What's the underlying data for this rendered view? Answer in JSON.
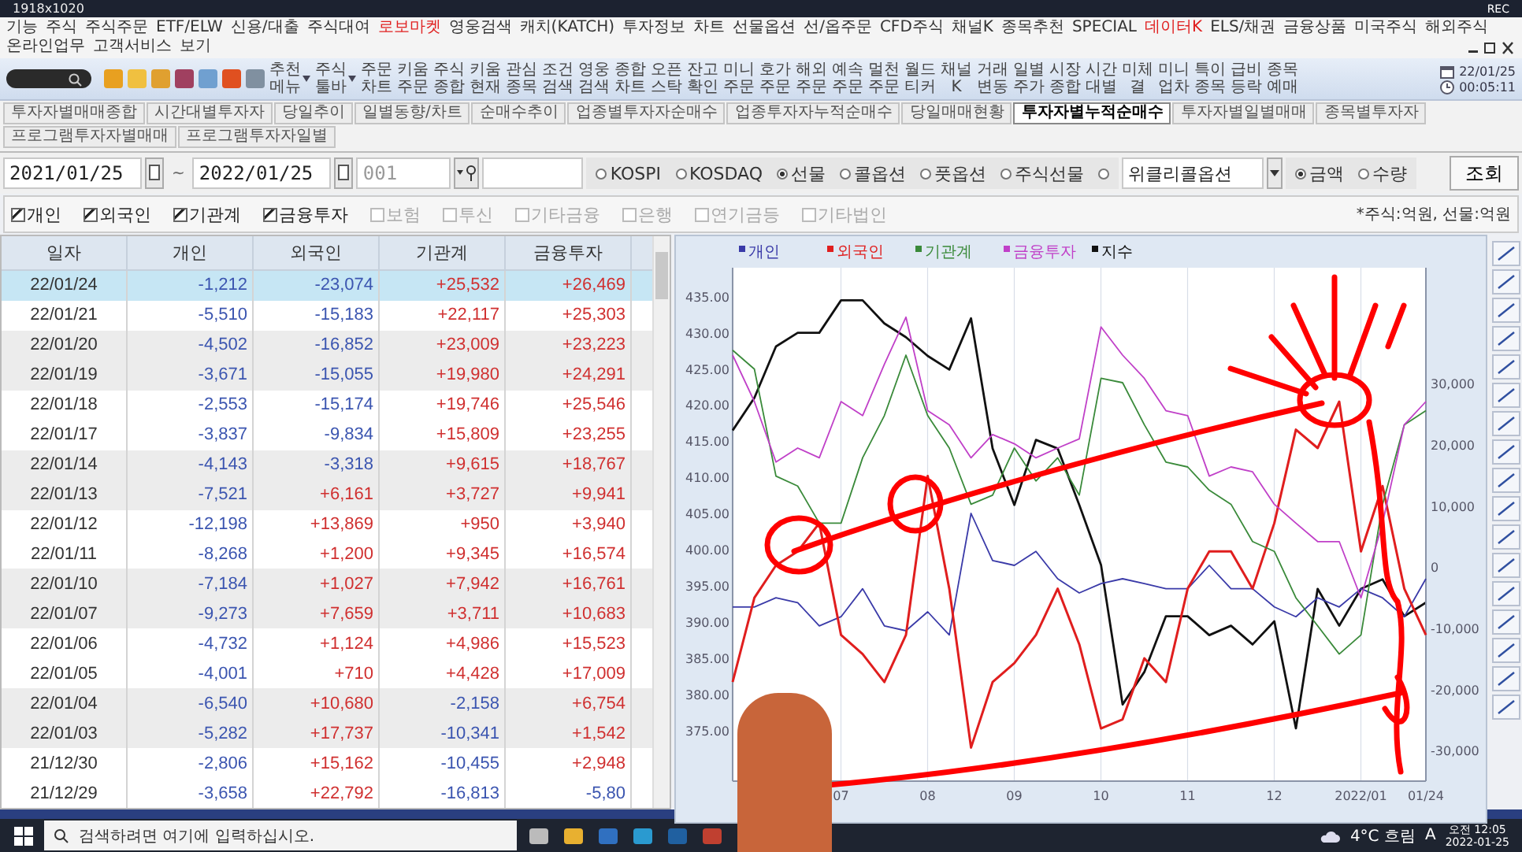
{
  "window": {
    "title": "1918x1020",
    "recording": "REC"
  },
  "menu": [
    {
      "label": "기능",
      "highlighted": false
    },
    {
      "label": "주식",
      "highlighted": false
    },
    {
      "label": "주식주문",
      "highlighted": false
    },
    {
      "label": "ETF/ELW",
      "highlighted": false
    },
    {
      "label": "신용/대출",
      "highlighted": false
    },
    {
      "label": "주식대여",
      "highlighted": false
    },
    {
      "label": "로보마켓",
      "highlighted": true
    },
    {
      "label": "영웅검색",
      "highlighted": false
    },
    {
      "label": "캐치(KATCH)",
      "highlighted": false
    },
    {
      "label": "투자정보",
      "highlighted": false
    },
    {
      "label": "차트",
      "highlighted": false
    },
    {
      "label": "선물옵션",
      "highlighted": false
    },
    {
      "label": "선/옵주문",
      "highlighted": false
    },
    {
      "label": "CFD주식",
      "highlighted": false
    },
    {
      "label": "채널K",
      "highlighted": false
    },
    {
      "label": "종목추천",
      "highlighted": false
    },
    {
      "label": "SPECIAL",
      "highlighted": false
    },
    {
      "label": "데이터K",
      "highlighted": true
    },
    {
      "label": "ELS/채권",
      "highlighted": false
    },
    {
      "label": "금융상품",
      "highlighted": false
    },
    {
      "label": "미국주식",
      "highlighted": false
    },
    {
      "label": "해외주식",
      "highlighted": false
    },
    {
      "label": "온라인업무",
      "highlighted": false
    },
    {
      "label": "고객서비스",
      "highlighted": false
    },
    {
      "label": "보기",
      "highlighted": false
    }
  ],
  "toolbar": {
    "buttons": [
      {
        "label": "추천 메뉴",
        "has_menu": true
      },
      {
        "label": "주식 툴바",
        "has_menu": true
      },
      {
        "label": "주문 차트",
        "has_menu": false
      },
      {
        "label": "키움 주문",
        "has_menu": false
      },
      {
        "label": "주식 종합",
        "has_menu": false
      },
      {
        "label": "키움 현재",
        "has_menu": false
      },
      {
        "label": "관심 종목",
        "has_menu": false
      },
      {
        "label": "조건 검색",
        "has_menu": false
      },
      {
        "label": "영웅 검색",
        "has_menu": false
      },
      {
        "label": "종합 차트",
        "has_menu": false
      },
      {
        "label": "오픈 스탁",
        "has_menu": false
      },
      {
        "label": "잔고 확인",
        "has_menu": false
      },
      {
        "label": "미니 주문",
        "has_menu": false
      },
      {
        "label": "호가 주문",
        "has_menu": false
      },
      {
        "label": "해외 주문",
        "has_menu": false
      },
      {
        "label": "예속 주문",
        "has_menu": false
      },
      {
        "label": "멀천 주문",
        "has_menu": false
      },
      {
        "label": "월드 티커",
        "has_menu": false
      },
      {
        "label": "채널 K",
        "has_menu": false
      },
      {
        "label": "거래 변동",
        "has_menu": false
      },
      {
        "label": "일별 주가",
        "has_menu": false
      },
      {
        "label": "시장 종합",
        "has_menu": false
      },
      {
        "label": "시간 대별",
        "has_menu": false
      },
      {
        "label": "미체 결",
        "has_menu": false
      },
      {
        "label": "미니 업차",
        "has_menu": false
      },
      {
        "label": "특이 종목",
        "has_menu": false
      },
      {
        "label": "급비 등락",
        "has_menu": false
      },
      {
        "label": "종목 예매",
        "has_menu": false
      }
    ],
    "date": "22/01/25",
    "time": "00:05:11"
  },
  "tabs": [
    {
      "label": "투자자별매매종합",
      "selected": false
    },
    {
      "label": "시간대별투자자",
      "selected": false
    },
    {
      "label": "당일추이",
      "selected": false
    },
    {
      "label": "일별동향/차트",
      "selected": false
    },
    {
      "label": "순매수추이",
      "selected": false
    },
    {
      "label": "업종별투자자순매수",
      "selected": false
    },
    {
      "label": "업종투자자누적순매수",
      "selected": false
    },
    {
      "label": "당일매매현황",
      "selected": false
    },
    {
      "label": "투자자별누적순매수",
      "selected": true
    },
    {
      "label": "투자자별일별매매",
      "selected": false
    },
    {
      "label": "종목별투자자",
      "selected": false
    },
    {
      "label": "프로그램투자자별매매",
      "selected": false
    },
    {
      "label": "프로그램투자자일별",
      "selected": false
    }
  ],
  "query": {
    "start_date": "2021/01/25",
    "range_sep": "~",
    "end_date": "2022/01/25",
    "code": "001",
    "markets": [
      {
        "label": "KOSPI",
        "selected": false
      },
      {
        "label": "KOSDAQ",
        "selected": false
      },
      {
        "label": "선물",
        "selected": true
      },
      {
        "label": "콜옵션",
        "selected": false
      },
      {
        "label": "풋옵션",
        "selected": false
      },
      {
        "label": "주식선물",
        "selected": false
      }
    ],
    "weekly_radio": {
      "selected": false
    },
    "weekly_option": "위클리콜옵션",
    "units": [
      {
        "label": "금액",
        "selected": true
      },
      {
        "label": "수량",
        "selected": false
      }
    ],
    "search_button": "조회"
  },
  "investors": [
    {
      "label": "개인",
      "checked": true,
      "disabled": false
    },
    {
      "label": "외국인",
      "checked": true,
      "disabled": false
    },
    {
      "label": "기관계",
      "checked": true,
      "disabled": false
    },
    {
      "label": "금융투자",
      "checked": true,
      "disabled": false
    },
    {
      "label": "보험",
      "checked": false,
      "disabled": true
    },
    {
      "label": "투신",
      "checked": false,
      "disabled": true
    },
    {
      "label": "기타금융",
      "checked": false,
      "disabled": true
    },
    {
      "label": "은행",
      "checked": false,
      "disabled": true
    },
    {
      "label": "연기금등",
      "checked": false,
      "disabled": true
    },
    {
      "label": "기타법인",
      "checked": false,
      "disabled": true
    }
  ],
  "unit_note": "*주식:억원, 선물:억원",
  "table": {
    "columns": [
      "일자",
      "개인",
      "외국인",
      "기관계",
      "금융투자"
    ],
    "rows": [
      {
        "date": "22/01/24",
        "selected": true,
        "values": [
          {
            "text": "-1,212",
            "color": "#3b55b0"
          },
          {
            "text": "-23,074",
            "color": "#3b55b0"
          },
          {
            "text": "+25,532",
            "color": "#d03030"
          },
          {
            "text": "+26,469",
            "color": "#d03030"
          }
        ]
      },
      {
        "date": "22/01/21",
        "selected": false,
        "values": [
          {
            "text": "-5,510",
            "color": "#3b55b0"
          },
          {
            "text": "-15,183",
            "color": "#3b55b0"
          },
          {
            "text": "+22,117",
            "color": "#d03030"
          },
          {
            "text": "+25,303",
            "color": "#d03030"
          }
        ]
      },
      {
        "date": "22/01/20",
        "selected": false,
        "values": [
          {
            "text": "-4,502",
            "color": "#3b55b0"
          },
          {
            "text": "-16,852",
            "color": "#3b55b0"
          },
          {
            "text": "+23,009",
            "color": "#d03030"
          },
          {
            "text": "+23,223",
            "color": "#d03030"
          }
        ]
      },
      {
        "date": "22/01/19",
        "selected": false,
        "values": [
          {
            "text": "-3,671",
            "color": "#3b55b0"
          },
          {
            "text": "-15,055",
            "color": "#3b55b0"
          },
          {
            "text": "+19,980",
            "color": "#d03030"
          },
          {
            "text": "+24,291",
            "color": "#d03030"
          }
        ]
      },
      {
        "date": "22/01/18",
        "selected": false,
        "values": [
          {
            "text": "-2,553",
            "color": "#3b55b0"
          },
          {
            "text": "-15,174",
            "color": "#3b55b0"
          },
          {
            "text": "+19,746",
            "color": "#d03030"
          },
          {
            "text": "+25,546",
            "color": "#d03030"
          }
        ]
      },
      {
        "date": "22/01/17",
        "selected": false,
        "values": [
          {
            "text": "-3,837",
            "color": "#3b55b0"
          },
          {
            "text": "-9,834",
            "color": "#3b55b0"
          },
          {
            "text": "+15,809",
            "color": "#d03030"
          },
          {
            "text": "+23,255",
            "color": "#d03030"
          }
        ]
      },
      {
        "date": "22/01/14",
        "selected": false,
        "values": [
          {
            "text": "-4,143",
            "color": "#3b55b0"
          },
          {
            "text": "-3,318",
            "color": "#3b55b0"
          },
          {
            "text": "+9,615",
            "color": "#d03030"
          },
          {
            "text": "+18,767",
            "color": "#d03030"
          }
        ]
      },
      {
        "date": "22/01/13",
        "selected": false,
        "values": [
          {
            "text": "-7,521",
            "color": "#3b55b0"
          },
          {
            "text": "+6,161",
            "color": "#d03030"
          },
          {
            "text": "+3,727",
            "color": "#d03030"
          },
          {
            "text": "+9,941",
            "color": "#d03030"
          }
        ]
      },
      {
        "date": "22/01/12",
        "selected": false,
        "values": [
          {
            "text": "-12,198",
            "color": "#3b55b0"
          },
          {
            "text": "+13,869",
            "color": "#d03030"
          },
          {
            "text": "+950",
            "color": "#d03030"
          },
          {
            "text": "+3,940",
            "color": "#d03030"
          }
        ]
      },
      {
        "date": "22/01/11",
        "selected": false,
        "values": [
          {
            "text": "-8,268",
            "color": "#3b55b0"
          },
          {
            "text": "+1,200",
            "color": "#d03030"
          },
          {
            "text": "+9,345",
            "color": "#d03030"
          },
          {
            "text": "+16,574",
            "color": "#d03030"
          }
        ]
      },
      {
        "date": "22/01/10",
        "selected": false,
        "values": [
          {
            "text": "-7,184",
            "color": "#3b55b0"
          },
          {
            "text": "+1,027",
            "color": "#d03030"
          },
          {
            "text": "+7,942",
            "color": "#d03030"
          },
          {
            "text": "+16,761",
            "color": "#d03030"
          }
        ]
      },
      {
        "date": "22/01/07",
        "selected": false,
        "values": [
          {
            "text": "-9,273",
            "color": "#3b55b0"
          },
          {
            "text": "+7,659",
            "color": "#d03030"
          },
          {
            "text": "+3,711",
            "color": "#d03030"
          },
          {
            "text": "+10,683",
            "color": "#d03030"
          }
        ]
      },
      {
        "date": "22/01/06",
        "selected": false,
        "values": [
          {
            "text": "-4,732",
            "color": "#3b55b0"
          },
          {
            "text": "+1,124",
            "color": "#d03030"
          },
          {
            "text": "+4,986",
            "color": "#d03030"
          },
          {
            "text": "+15,523",
            "color": "#d03030"
          }
        ]
      },
      {
        "date": "22/01/05",
        "selected": false,
        "values": [
          {
            "text": "-4,001",
            "color": "#3b55b0"
          },
          {
            "text": "+710",
            "color": "#d03030"
          },
          {
            "text": "+4,428",
            "color": "#d03030"
          },
          {
            "text": "+17,009",
            "color": "#d03030"
          }
        ]
      },
      {
        "date": "22/01/04",
        "selected": false,
        "values": [
          {
            "text": "-6,540",
            "color": "#3b55b0"
          },
          {
            "text": "+10,680",
            "color": "#d03030"
          },
          {
            "text": "-2,158",
            "color": "#3b55b0"
          },
          {
            "text": "+6,754",
            "color": "#d03030"
          }
        ]
      },
      {
        "date": "22/01/03",
        "selected": false,
        "values": [
          {
            "text": "-5,282",
            "color": "#3b55b0"
          },
          {
            "text": "+17,737",
            "color": "#d03030"
          },
          {
            "text": "-10,341",
            "color": "#3b55b0"
          },
          {
            "text": "+1,542",
            "color": "#d03030"
          }
        ]
      },
      {
        "date": "21/12/30",
        "selected": false,
        "values": [
          {
            "text": "-2,806",
            "color": "#3b55b0"
          },
          {
            "text": "+15,162",
            "color": "#d03030"
          },
          {
            "text": "-10,455",
            "color": "#3b55b0"
          },
          {
            "text": "+2,948",
            "color": "#d03030"
          }
        ]
      },
      {
        "date": "21/12/29",
        "selected": false,
        "values": [
          {
            "text": "-3,658",
            "color": "#3b55b0"
          },
          {
            "text": "+22,792",
            "color": "#d03030"
          },
          {
            "text": "-16,813",
            "color": "#3b55b0"
          },
          {
            "text": "-5,80",
            "color": "#3b55b0"
          }
        ]
      }
    ]
  },
  "chart": {
    "flow": {
      "chart_data": {
        "type": "line",
        "x": [
          5.75,
          6,
          6.25,
          6.5,
          6.75,
          7,
          7.25,
          7.5,
          7.75,
          8,
          8.25,
          8.5,
          8.75,
          9,
          9.25,
          9.5,
          9.75,
          10,
          10.25,
          10.5,
          10.75,
          11,
          11.25,
          11.5,
          11.75,
          12,
          12.25,
          12.5,
          12.75,
          13,
          13.25,
          13.5,
          13.75
        ],
        "xlim": [
          5.75,
          13.75
        ],
        "ylim": [
          -35000,
          49000
        ],
        "xticks": [
          {
            "value": 7,
            "label": "07"
          },
          {
            "value": 8,
            "label": "08"
          },
          {
            "value": 9,
            "label": "09"
          },
          {
            "value": 10,
            "label": "10"
          },
          {
            "value": 11,
            "label": "11"
          },
          {
            "value": 12,
            "label": "12"
          },
          {
            "value": 13,
            "label": "2022/01"
          },
          {
            "value": 13.75,
            "label": "01/24"
          }
        ],
        "yticks": [
          {
            "value": 30000,
            "label": "30,000"
          },
          {
            "value": 20000,
            "label": "20,000"
          },
          {
            "value": 10000,
            "label": "10,000"
          },
          {
            "value": 0,
            "label": "0"
          },
          {
            "value": -10000,
            "label": "-10,000"
          },
          {
            "value": -20000,
            "label": "-20,000"
          },
          {
            "value": -30000,
            "label": "-30,000"
          }
        ],
        "series": [
          {
            "name": "개인",
            "color": "#3a3aa8",
            "values": [
              -6500,
              -6500,
              -5000,
              -5800,
              -9600,
              -8100,
              -3500,
              -9600,
              -10400,
              -7300,
              -11100,
              8800,
              1100,
              300,
              2600,
              -1900,
              -4200,
              -2700,
              -1900,
              -2700,
              -3500,
              -3500,
              300,
              -3500,
              -3500,
              -6500,
              -8100,
              -5000,
              -6500,
              -3500,
              -5000,
              -8100,
              -1900
            ]
          },
          {
            "name": "외국인",
            "color": "#e01e1e",
            "values": [
              -18800,
              -5000,
              300,
              2600,
              7200,
              -11100,
              -14200,
              -18800,
              -11100,
              14900,
              -3500,
              -29500,
              -18800,
              -15700,
              -11100,
              -3500,
              -12600,
              -26400,
              -24900,
              -14900,
              -18800,
              -3500,
              2600,
              2600,
              -3500,
              7200,
              22500,
              19500,
              27100,
              2600,
              13300,
              -3500,
              -11100
            ]
          },
          {
            "name": "기관계",
            "color": "#3a8a3a",
            "values": [
              35500,
              32400,
              14900,
              13300,
              7200,
              7200,
              17900,
              24800,
              34700,
              24800,
              19500,
              10300,
              11800,
              19500,
              14100,
              17900,
              11800,
              30900,
              30200,
              23300,
              17200,
              16400,
              12600,
              10300,
              4200,
              2600,
              -5000,
              -9600,
              -14200,
              -11100,
              10300,
              23300,
              25600
            ]
          },
          {
            "name": "금융투자",
            "color": "#c040c8",
            "values": [
              34700,
              27100,
              17200,
              19500,
              17900,
              27100,
              24800,
              33200,
              40900,
              25600,
              23300,
              17900,
              21700,
              20200,
              17900,
              19500,
              21000,
              39300,
              34700,
              30900,
              25600,
              24800,
              14900,
              16400,
              15600,
              10300,
              7200,
              4200,
              4200,
              -5000,
              7200,
              23300,
              27100
            ]
          }
        ]
      }
    },
    "index": {
      "chart_data": {
        "type": "line",
        "x": [
          5.75,
          6,
          6.25,
          6.5,
          6.75,
          7,
          7.25,
          7.5,
          7.75,
          8,
          8.25,
          8.5,
          8.75,
          9,
          9.25,
          9.5,
          9.75,
          10,
          10.25,
          10.5,
          10.75,
          11,
          11.25,
          11.5,
          11.75,
          12,
          12.25,
          12.5,
          12.75,
          13,
          13.25,
          13.5,
          13.75
        ],
        "xlim": [
          5.75,
          13.75
        ],
        "ylim": [
          368,
          439
        ],
        "grid": true,
        "yticks": [
          {
            "value": 435,
            "label": "435.00"
          },
          {
            "value": 430,
            "label": "430.00"
          },
          {
            "value": 425,
            "label": "425.00"
          },
          {
            "value": 420,
            "label": "420.00"
          },
          {
            "value": 415,
            "label": "415.00"
          },
          {
            "value": 410,
            "label": "410.00"
          },
          {
            "value": 405,
            "label": "405.00"
          },
          {
            "value": 400,
            "label": "400.00"
          },
          {
            "value": 395,
            "label": "395.00"
          },
          {
            "value": 390,
            "label": "390.00"
          },
          {
            "value": 385,
            "label": "385.00"
          },
          {
            "value": 380,
            "label": "380.00"
          },
          {
            "value": 375,
            "label": "375.00"
          }
        ],
        "series": [
          {
            "name": "지수",
            "color": "#111111",
            "values": [
              416.5,
              421.0,
              428.1,
              430.0,
              430.0,
              434.5,
              434.5,
              431.3,
              429.4,
              426.8,
              424.9,
              432.0,
              414.0,
              406.2,
              415.2,
              414.0,
              406.2,
              397.9,
              378.6,
              383.1,
              390.8,
              390.8,
              388.2,
              389.5,
              386.9,
              390.1,
              375.3,
              394.6,
              389.5,
              394.6,
              395.9,
              390.8,
              392.7
            ]
          }
        ]
      }
    }
  },
  "taskbar": {
    "search_placeholder": "검색하려면 여기에 입력하십시오.",
    "weather": "4°C 흐림",
    "ime": "A",
    "time": "오전 12:05",
    "date": "2022-01-25"
  }
}
